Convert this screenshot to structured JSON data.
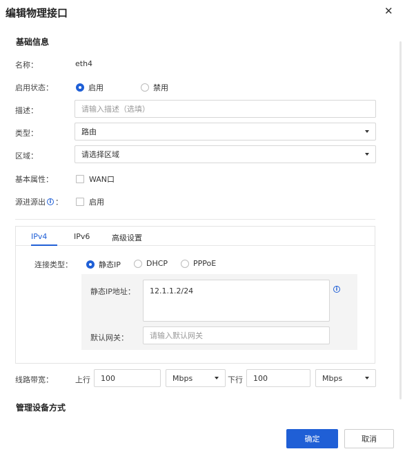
{
  "dialog": {
    "title": "编辑物理接口",
    "close_glyph": "✕"
  },
  "basic": {
    "section_title": "基础信息",
    "name_label": "名称：",
    "name_value": "eth4",
    "enable_label": "启用状态：",
    "enable_options": [
      {
        "label": "启用",
        "selected": true
      },
      {
        "label": "禁用",
        "selected": false
      }
    ],
    "desc_label": "描述：",
    "desc_placeholder": "请输入描述（选填）",
    "type_label": "类型：",
    "type_value": "路由",
    "zone_label": "区域：",
    "zone_value": "请选择区域",
    "attr_label": "基本属性：",
    "attr_checkbox": "WAN口",
    "srcin_label": "源进源出",
    "srcin_suffix": "：",
    "srcin_checkbox": "启用"
  },
  "tabs": {
    "items": [
      {
        "label": "IPv4",
        "active": true
      },
      {
        "label": "IPv6",
        "active": false
      },
      {
        "label": "高级设置",
        "active": false
      }
    ],
    "conn_type_label": "连接类型：",
    "conn_options": [
      {
        "label": "静态IP",
        "selected": true
      },
      {
        "label": "DHCP",
        "selected": false
      },
      {
        "label": "PPPoE",
        "selected": false
      }
    ],
    "static_ip_label": "静态IP地址：",
    "static_ip_value": "12.1.1.2/24",
    "gateway_label": "默认网关：",
    "gateway_placeholder": "请输入默认网关"
  },
  "bandwidth": {
    "label": "线路带宽：",
    "up_label": "上行",
    "up_value": "100",
    "up_unit": "Mbps",
    "down_label": "下行",
    "down_value": "100",
    "down_unit": "Mbps"
  },
  "mgmt": {
    "section_title": "管理设备方式"
  },
  "footer": {
    "confirm": "确定",
    "cancel": "取消"
  },
  "colors": {
    "accent": "#1f5fd6",
    "border": "#d6d6d6",
    "panel_bg": "#f4f4f4"
  },
  "icons": {
    "close": "close-icon",
    "info": "info-icon",
    "caret": "chevron-down-icon"
  }
}
